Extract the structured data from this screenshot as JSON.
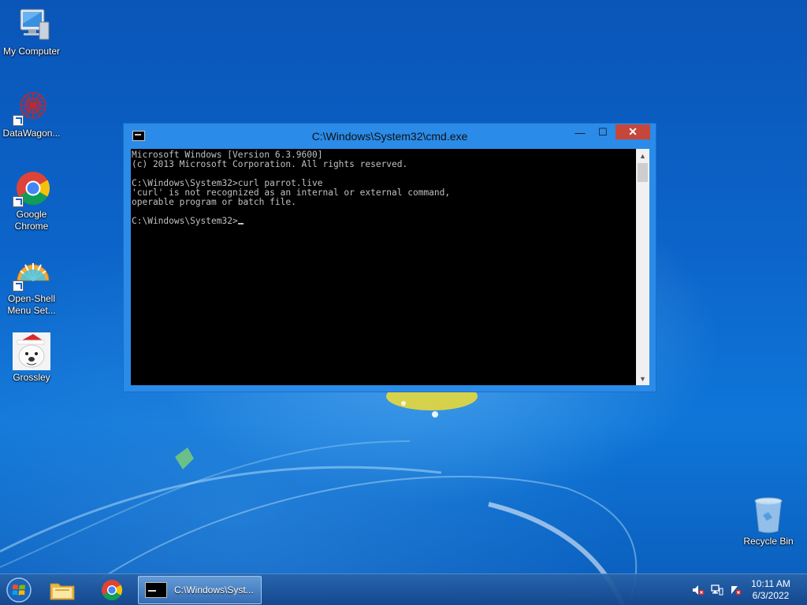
{
  "desktop": {
    "icons": [
      {
        "label": "My Computer"
      },
      {
        "label": "DataWagon..."
      },
      {
        "label": "Google\nChrome"
      },
      {
        "label": "Open-Shell\nMenu Set..."
      },
      {
        "label": "Grossley"
      },
      {
        "label": "Recycle Bin"
      }
    ]
  },
  "cmd_window": {
    "title": "C:\\Windows\\System32\\cmd.exe",
    "minimize_glyph": "—",
    "maximize_glyph": "☐",
    "close_glyph": "✕",
    "console_lines": [
      "Microsoft Windows [Version 6.3.9600]",
      "(c) 2013 Microsoft Corporation. All rights reserved.",
      "",
      "C:\\Windows\\System32>curl parrot.live",
      "'curl' is not recognized as an internal or external command,",
      "operable program or batch file.",
      "",
      "C:\\Windows\\System32>"
    ],
    "scroll_up_glyph": "▲",
    "scroll_down_glyph": "▼"
  },
  "taskbar": {
    "active_window_label": "C:\\Windows\\Syst...",
    "clock_time": "10:11 AM",
    "clock_date": "6/3/2022"
  },
  "colors": {
    "console_bg": "#000000",
    "console_fg": "#c0c0c0",
    "window_frame": "#2a8be8",
    "close_button": "#c7463a"
  }
}
